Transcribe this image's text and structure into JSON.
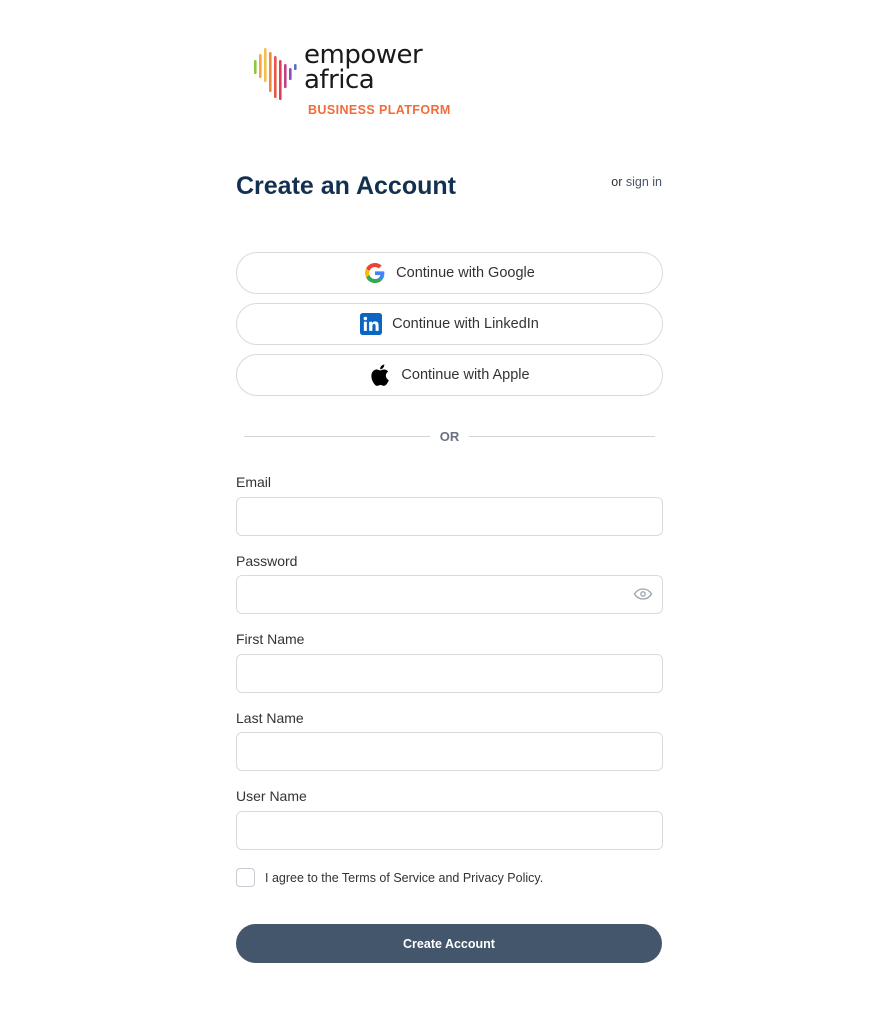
{
  "logo": {
    "word1": "empower",
    "word2": "africa",
    "tagline": "BUSINESS PLATFORM"
  },
  "header": {
    "title": "Create an Account",
    "signin_prefix": "or",
    "signin_link": "sign in"
  },
  "social": {
    "google": "Continue with Google",
    "linkedin": "Continue with LinkedIn",
    "apple": "Continue with Apple"
  },
  "divider": "OR",
  "form": {
    "email_label": "Email",
    "password_label": "Password",
    "first_name_label": "First Name",
    "last_name_label": "Last Name",
    "user_name_label": "User Name",
    "email_value": "",
    "password_value": "",
    "first_name_value": "",
    "last_name_value": "",
    "user_name_value": ""
  },
  "agree": {
    "prefix": "I agree to the",
    "terms": "Terms of Service",
    "and": "and",
    "privacy": "Privacy Policy",
    "suffix": "."
  },
  "submit_label": "Create Account",
  "colors": {
    "title": "#14304f",
    "accent_orange": "#f26b3a",
    "button_bg": "#43566b",
    "linkedin_blue": "#0a66c2"
  },
  "icons": {
    "google": "google-icon",
    "linkedin": "linkedin-icon",
    "apple": "apple-icon",
    "password_toggle": "eye-icon"
  }
}
